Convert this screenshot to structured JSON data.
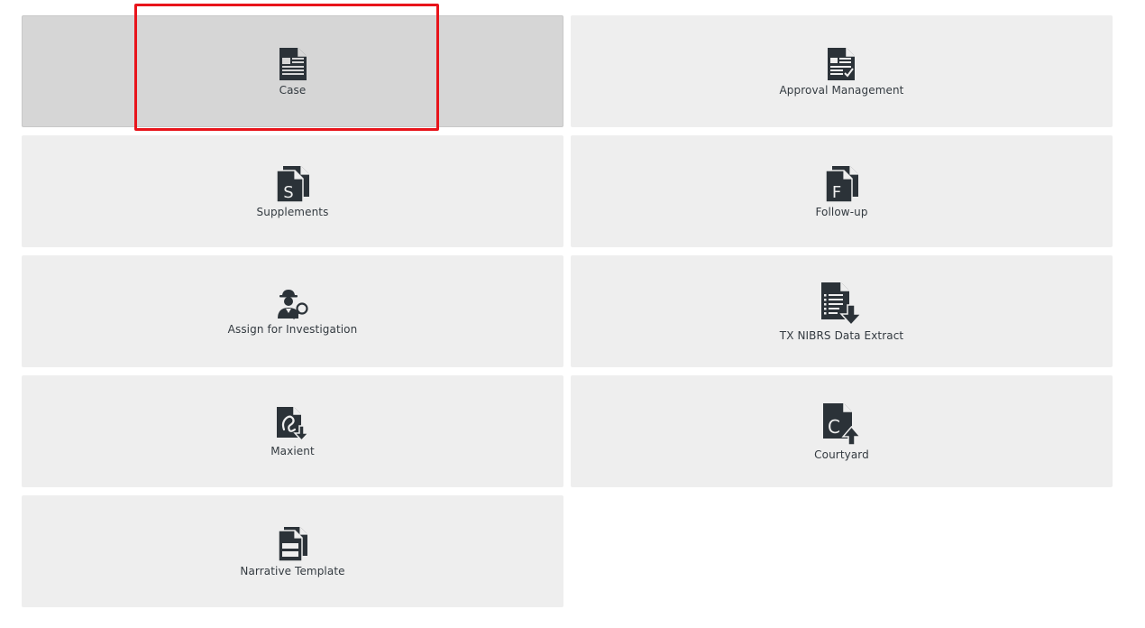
{
  "colors": {
    "tile_bg": "#eeeeee",
    "tile_selected_bg": "#d6d6d6",
    "icon": "#2b3238",
    "highlight": "#e8141b"
  },
  "tiles": [
    {
      "label": "Case",
      "icon": "document-lines-icon",
      "selected": true
    },
    {
      "label": "Approval Management",
      "icon": "document-check-icon",
      "selected": false
    },
    {
      "label": "Supplements",
      "icon": "document-s-icon",
      "selected": false
    },
    {
      "label": "Follow-up",
      "icon": "document-f-icon",
      "selected": false
    },
    {
      "label": "Assign for Investigation",
      "icon": "detective-magnifier-icon",
      "selected": false
    },
    {
      "label": "TX NIBRS Data Extract",
      "icon": "document-list-download-icon",
      "selected": false
    },
    {
      "label": "Maxient",
      "icon": "document-m-download-icon",
      "selected": false
    },
    {
      "label": "Courtyard",
      "icon": "document-c-upload-icon",
      "selected": false
    },
    {
      "label": "Narrative Template",
      "icon": "document-template-icon",
      "selected": false
    }
  ]
}
